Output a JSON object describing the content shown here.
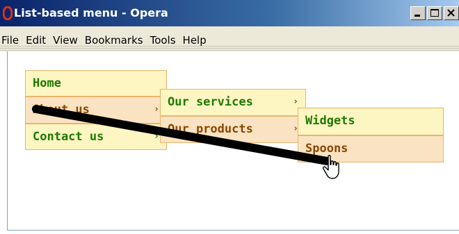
{
  "window": {
    "title": "List-based menu - Opera",
    "minimize_label": "_",
    "maximize_label": "□",
    "close_label": "×"
  },
  "menubar": {
    "items": [
      "File",
      "Edit",
      "View",
      "Bookmarks",
      "Tools",
      "Help"
    ]
  },
  "menu": {
    "level1": [
      {
        "label": "Home",
        "has_submenu": false
      },
      {
        "label": "About us",
        "has_submenu": true
      },
      {
        "label": "Contact us",
        "has_submenu": true
      }
    ],
    "level2": [
      {
        "label": "Our services",
        "has_submenu": true
      },
      {
        "label": "Our products",
        "has_submenu": true
      }
    ],
    "level3": [
      {
        "label": "Widgets"
      },
      {
        "label": "Spoons"
      }
    ],
    "arrow_glyph": "›"
  },
  "colors": {
    "item_green_bg": "#fdf5c2",
    "item_brown_bg": "#fae3c2",
    "item_border": "#e9b46b",
    "text_green": "#1f7a00",
    "text_brown": "#8a4800"
  }
}
